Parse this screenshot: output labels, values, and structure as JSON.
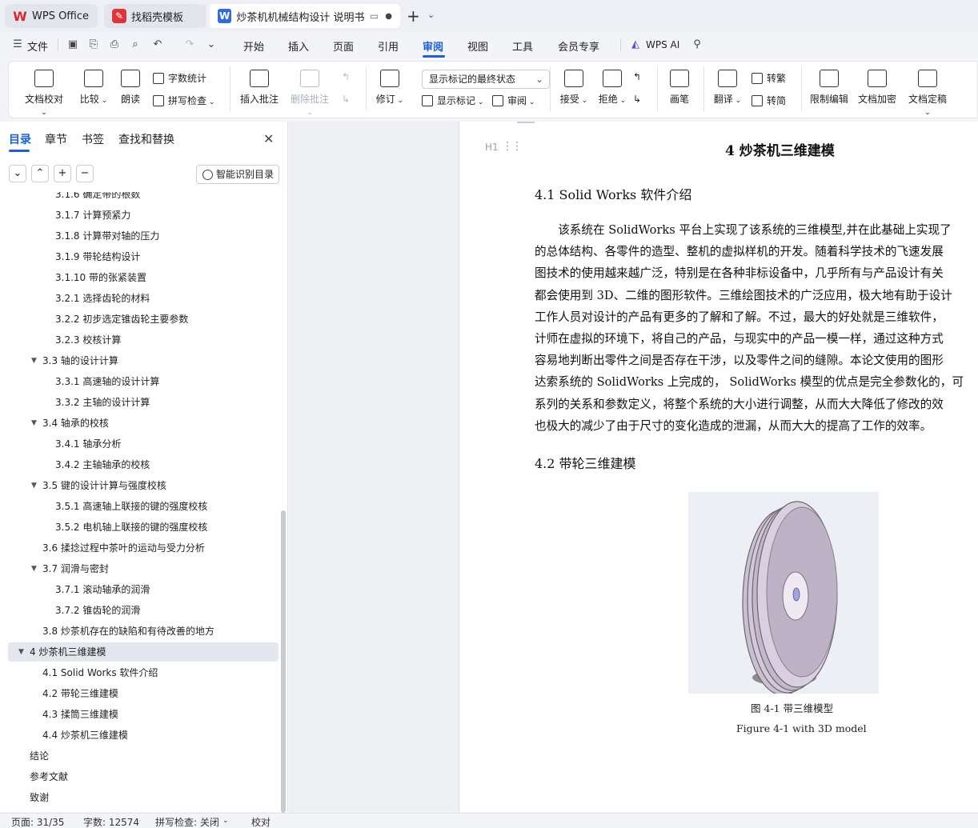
{
  "tabs": [
    {
      "label": "WPS Office"
    },
    {
      "label": "找稻壳模板"
    },
    {
      "label": "炒茶机机械结构设计 说明书（"
    }
  ],
  "menu": {
    "file": "文件",
    "items": [
      "开始",
      "插入",
      "页面",
      "引用",
      "审阅",
      "视图",
      "工具",
      "会员专享"
    ],
    "active": "审阅",
    "ai": "WPS AI"
  },
  "ribbon": {
    "doc_check": "文档校对",
    "compare": "比较",
    "read_aloud": "朗读",
    "word_count": "字数统计",
    "spell_check": "拼写检查",
    "insert_comment": "插入批注",
    "delete_comment": "删除批注",
    "track_changes": "修订",
    "markup_state": "显示标记的最终状态",
    "show_markup": "显示标记",
    "review": "审阅",
    "accept": "接受",
    "reject": "拒绝",
    "pen": "画笔",
    "translate": "翻译",
    "to_traditional": "转繁",
    "to_simplified": "转简",
    "restrict_edit": "限制编辑",
    "encrypt": "文档加密",
    "finalize": "文档定稿"
  },
  "nav": {
    "tabs": [
      "目录",
      "章节",
      "书签",
      "查找和替换"
    ],
    "active_tab": "目录",
    "smart_toc": "智能识别目录",
    "items": [
      {
        "label": "3.1.6 确定带的根数",
        "level": 3
      },
      {
        "label": "3.1.7 计算预紧力",
        "level": 3
      },
      {
        "label": "3.1.8 计算带对轴的压力",
        "level": 3
      },
      {
        "label": "3.1.9 带轮结构设计",
        "level": 3
      },
      {
        "label": "3.1.10 带的张紧装置",
        "level": 3
      },
      {
        "label": "3.2.1 选择齿轮的材料",
        "level": 3
      },
      {
        "label": "3.2.2 初步选定锥齿轮主要参数",
        "level": 3
      },
      {
        "label": "3.2.3 校核计算",
        "level": 3
      },
      {
        "label": "3.3 轴的设计计算",
        "level": 2,
        "expanded": true
      },
      {
        "label": "3.3.1 高速轴的设计计算",
        "level": 3
      },
      {
        "label": "3.3.2 主轴的设计计算",
        "level": 3
      },
      {
        "label": "3.4 轴承的校核",
        "level": 2,
        "expanded": true
      },
      {
        "label": "3.4.1 轴承分析",
        "level": 3
      },
      {
        "label": "3.4.2 主轴轴承的校核",
        "level": 3
      },
      {
        "label": "3.5 键的设计计算与强度校核",
        "level": 2,
        "expanded": true
      },
      {
        "label": "3.5.1 高速轴上联接的键的强度校核",
        "level": 3
      },
      {
        "label": "3.5.2 电机轴上联接的键的强度校核",
        "level": 3
      },
      {
        "label": "3.6 揉捻过程中茶叶的运动与受力分析",
        "level": 2
      },
      {
        "label": "3.7 润滑与密封",
        "level": 2,
        "expanded": true
      },
      {
        "label": "3.7.1 滚动轴承的润滑",
        "level": 3
      },
      {
        "label": "3.7.2 锥齿轮的润滑",
        "level": 3
      },
      {
        "label": "3.8 炒茶机存在的缺陷和有待改善的地方",
        "level": 2
      },
      {
        "label": "4  炒茶机三维建模",
        "level": 1,
        "expanded": true,
        "selected": true
      },
      {
        "label": "4.1 Solid Works 软件介绍",
        "level": 2
      },
      {
        "label": "4.2 带轮三维建模",
        "level": 2
      },
      {
        "label": "4.3 揉筒三维建模",
        "level": 2
      },
      {
        "label": "4.4 炒茶机三维建模",
        "level": 2
      },
      {
        "label": "结论",
        "level": 1
      },
      {
        "label": "参考文献",
        "level": 1
      },
      {
        "label": "致谢",
        "level": 1
      }
    ]
  },
  "document": {
    "heading_marker": "H1",
    "chapter_title": "4  炒茶机三维建模",
    "section1": "4.1 Solid Works 软件介绍",
    "paragraph_lines": [
      "　　该系统在  SolidWorks 平台上实现了该系统的三维模型,并在此基础上实现了",
      "的总体结构、各零件的造型、整机的虚拟样机的开发。随着科学技术的飞速发展",
      "图技术的使用越来越广泛，特别是在各种非标设备中，几乎所有与产品设计有关",
      "都会使用到 3D、二维的图形软件。三维绘图技术的广泛应用，极大地有助于设计",
      "工作人员对设计的产品有更多的了解和了解。不过，最大的好处就是三维软件，",
      "计师在虚拟的环境下，将自己的产品，与现实中的产品一模一样，通过这种方式",
      "容易地判断出零件之间是否存在干涉，以及零件之间的缝隙。本论文使用的图形",
      "达索系统的  SolidWorks 上完成的，  SolidWorks 模型的优点是完全参数化的，可",
      "系列的关系和参数定义，将整个系统的大小进行调整，从而大大降低了修改的效",
      "也极大的减少了由于尺寸的变化造成的泄漏，从而大大的提高了工作的效率。"
    ],
    "section2": "4.2 带轮三维建模",
    "figure_caption_cn": "图 4-1 带三维模型",
    "figure_caption_en": "Figure 4-1 with 3D model"
  },
  "status": {
    "page": "页面: 31/35",
    "words": "字数: 12574",
    "spell": "拼写检查: 关闭",
    "proof": "校对"
  }
}
